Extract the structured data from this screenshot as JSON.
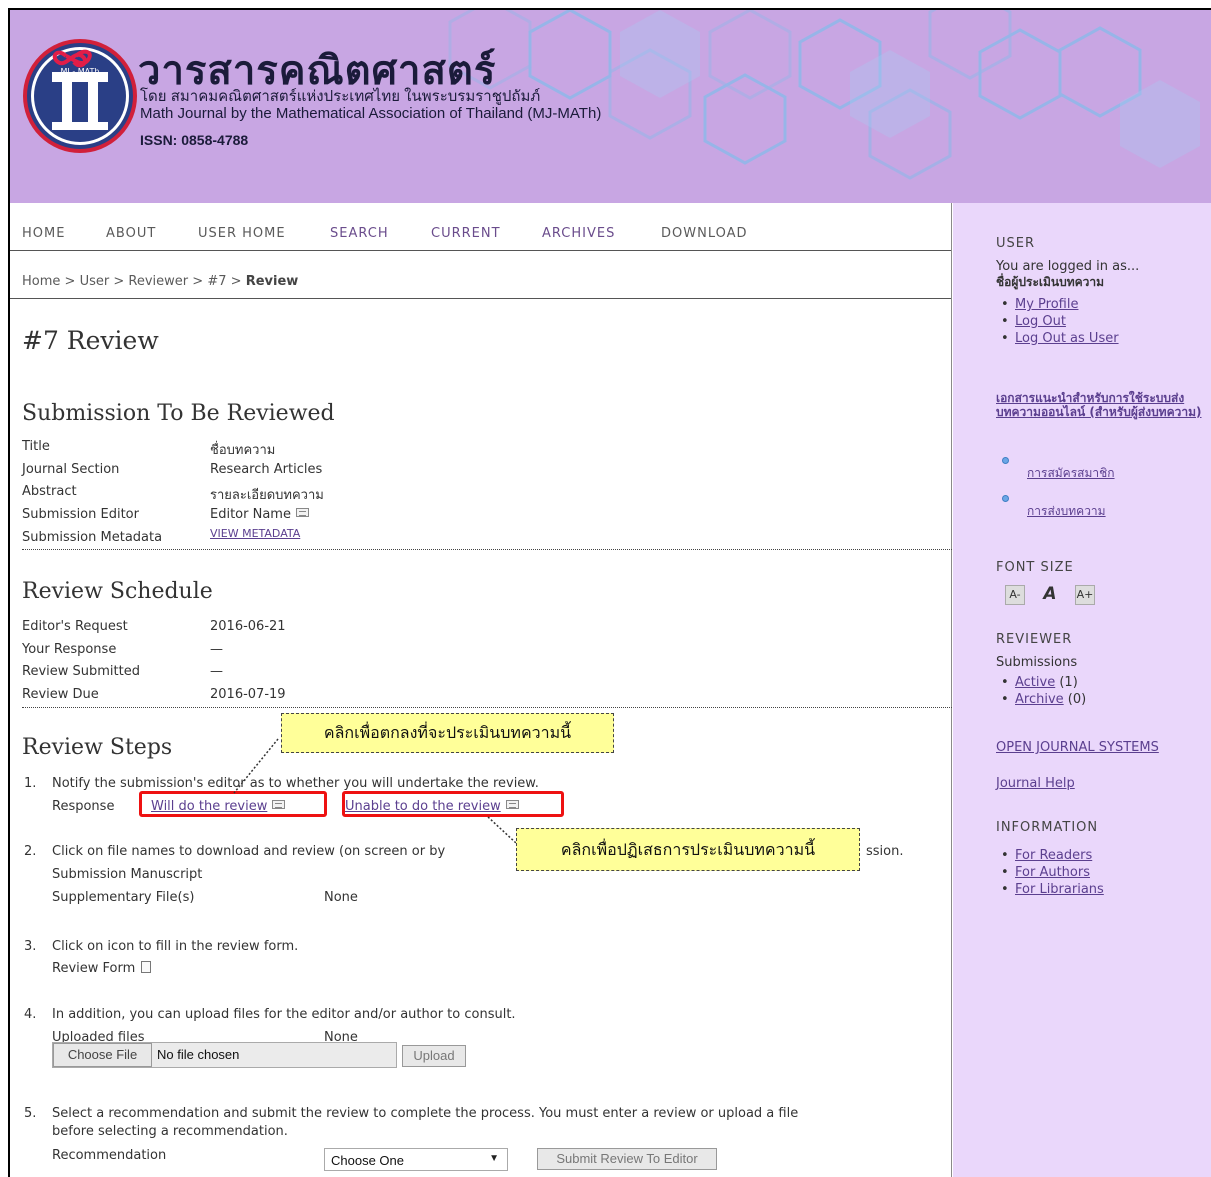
{
  "header": {
    "title": "วารสารคณิตศาสตร์",
    "subtitle_th": "โดย สมาคมคณิตศาสตร์แห่งประเทศไทย ในพระบรมราชูปถัมภ์",
    "subtitle_en": "Math Journal by the Mathematical Association of Thailand (MJ-MATh)",
    "issn": "ISSN: 0858-4788",
    "logo_text": "MJ - MATh",
    "colors": {
      "background": "#c8a6e3",
      "title": "#1b1b3a"
    }
  },
  "nav": {
    "home": "HOME",
    "about": "ABOUT",
    "user_home": "USER HOME",
    "search": "SEARCH",
    "current": "CURRENT",
    "archives": "ARCHIVES",
    "download": "DOWNLOAD"
  },
  "breadcrumb": {
    "home": "Home",
    "user": "User",
    "reviewer": "Reviewer",
    "id": "#7",
    "current": "Review",
    "separator": ">"
  },
  "page_title": "#7 Review",
  "submission": {
    "heading": "Submission To Be Reviewed",
    "title_label": "Title",
    "title_value": "ชื่อบทความ",
    "section_label": "Journal Section",
    "section_value": "Research Articles",
    "abstract_label": "Abstract",
    "abstract_value": "รายละเอียดบทความ",
    "editor_label": "Submission Editor",
    "editor_value": "Editor Name",
    "metadata_label": "Submission Metadata",
    "metadata_link": "VIEW METADATA"
  },
  "schedule": {
    "heading": "Review Schedule",
    "request_label": "Editor's Request",
    "request_value": "2016-06-21",
    "response_label": "Your Response",
    "response_value": "—",
    "submitted_label": "Review Submitted",
    "submitted_value": "—",
    "due_label": "Review Due",
    "due_value": "2016-07-19"
  },
  "steps": {
    "heading": "Review Steps",
    "s1_num": "1.",
    "s1_text": "Notify the submission's editor as to whether you will undertake the review.",
    "s1_response_label": "Response",
    "s1_accept": "Will do the review",
    "s1_decline": "Unable to do the review",
    "s2_num": "2.",
    "s2_text_a": "Click on file names to download and review (on screen or by",
    "s2_text_b": "ssion.",
    "s2_manuscript": "Submission Manuscript",
    "s2_supp_label": "Supplementary File(s)",
    "s2_supp_value": "None",
    "s3_num": "3.",
    "s3_text": "Click on icon to fill in the review form.",
    "s3_form": "Review Form",
    "s4_num": "4.",
    "s4_text": "In addition, you can upload files for the editor and/or author to consult.",
    "s4_uploaded_label": "Uploaded files",
    "s4_uploaded_value": "None",
    "s4_choose_file": "Choose File",
    "s4_no_file": "No file chosen",
    "s4_upload": "Upload",
    "s5_num": "5.",
    "s5_text_a": "Select a recommendation and submit the review to complete the process. You must enter a review or upload a file",
    "s5_text_b": "before selecting a recommendation.",
    "s5_rec_label": "Recommendation",
    "s5_select": "Choose One",
    "s5_submit": "Submit Review To Editor"
  },
  "callouts": {
    "accept": "คลิกเพื่อตกลงที่จะประเมินบทความนี้",
    "decline": "คลิกเพื่อปฏิเสธการประเมินบทความนี้"
  },
  "sidebar": {
    "user_heading": "USER",
    "logged_in": "You are logged in as...",
    "username": "ชื่อผู้ประเมินบทความ",
    "my_profile": "My Profile",
    "log_out": "Log Out",
    "log_out_as_user": "Log Out as User",
    "docs_link": "เอกสารแนะนำสำหรับการใช้ระบบส่งบทความออนไลน์ (สำหรับผู้ส่งบทความ)",
    "docs_item1": "การสมัครสมาชิก",
    "docs_item2": "การส่งบทความ",
    "font_size_heading": "FONT SIZE",
    "reviewer_heading": "REVIEWER",
    "submissions": "Submissions",
    "active": "Active",
    "active_count": "(1)",
    "archive": "Archive",
    "archive_count": "(0)",
    "ojs": "OPEN JOURNAL SYSTEMS",
    "journal_help": "Journal Help",
    "information_heading": "INFORMATION",
    "for_readers": "For Readers",
    "for_authors": "For Authors",
    "for_librarians": "For Librarians",
    "colors": {
      "background": "#ead7fb",
      "link": "#5b3f8f"
    }
  }
}
